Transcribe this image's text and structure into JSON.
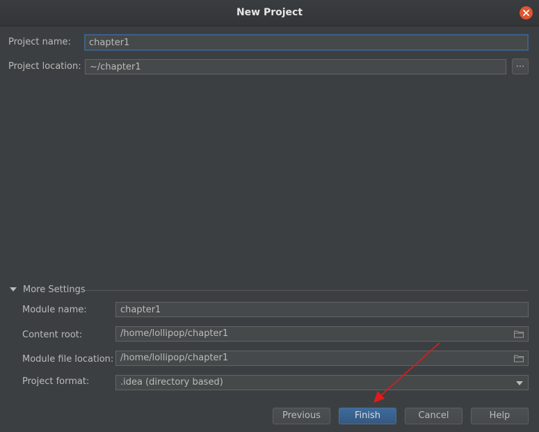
{
  "window": {
    "title": "New Project"
  },
  "project": {
    "name_label": "Project name:",
    "name_value": "chapter1",
    "location_label": "Project location:",
    "location_value": "~/chapter1",
    "browse_label": "..."
  },
  "more_settings": {
    "label": "More Settings",
    "module_name_label": "Module name:",
    "module_name_value": "chapter1",
    "content_root_label": "Content root:",
    "content_root_value": "/home/lollipop/chapter1",
    "module_file_label": "Module file location:",
    "module_file_value": "/home/lollipop/chapter1",
    "format_label": "Project format:",
    "format_value": ".idea (directory based)"
  },
  "buttons": {
    "previous": "Previous",
    "finish": "Finish",
    "cancel": "Cancel",
    "help": "Help"
  },
  "colors": {
    "background": "#3c3f41",
    "focus_border": "#3d6185",
    "default_button": "#365880",
    "close_button": "#e0552f",
    "annotation_arrow": "#e01b1b"
  }
}
